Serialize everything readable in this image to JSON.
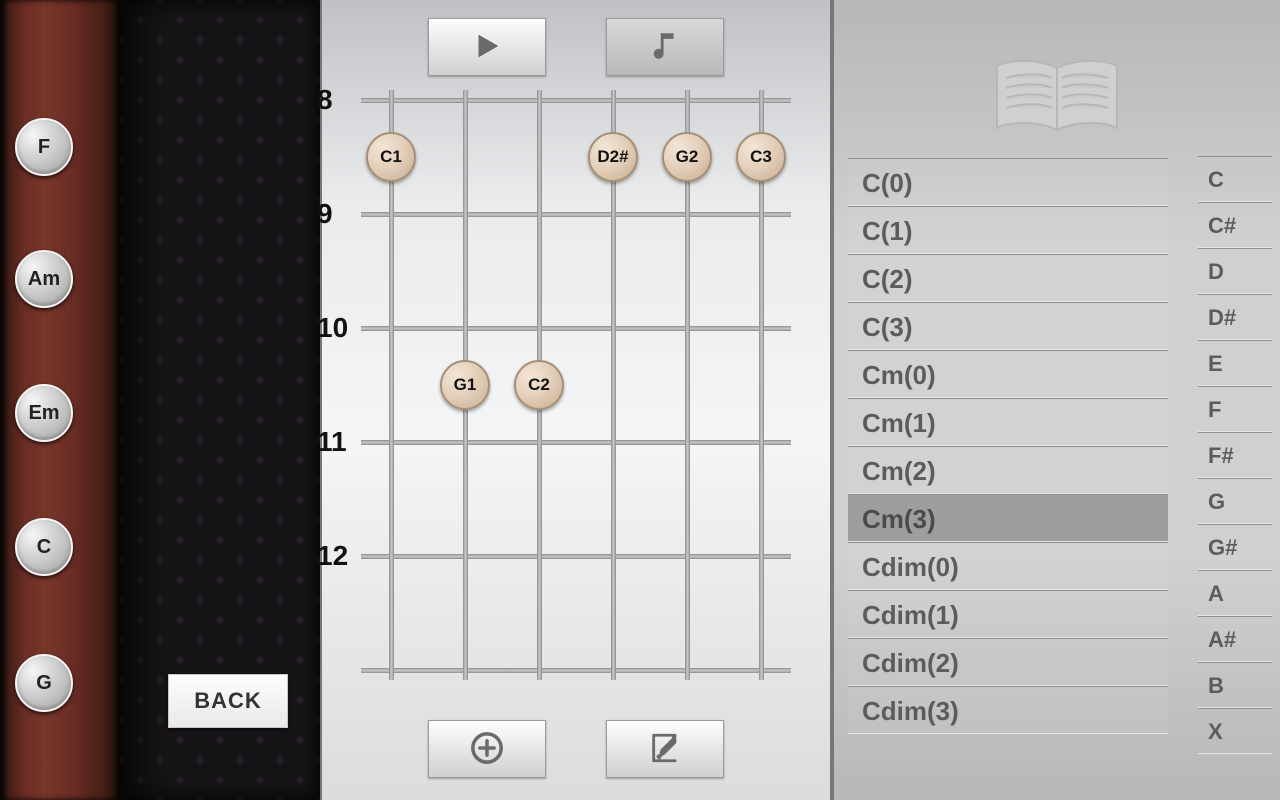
{
  "left_panel": {
    "chord_buttons": [
      "F",
      "Am",
      "Em",
      "C",
      "G"
    ],
    "back_label": "BACK"
  },
  "center_panel": {
    "fretboard": {
      "string_count": 6,
      "fret_labels": [
        "8",
        "9",
        "10",
        "11",
        "12"
      ],
      "dots": [
        {
          "label": "C1",
          "string": 0,
          "row": 0
        },
        {
          "label": "D2#",
          "string": 3,
          "row": 0
        },
        {
          "label": "G2",
          "string": 4,
          "row": 0
        },
        {
          "label": "C3",
          "string": 5,
          "row": 0
        },
        {
          "label": "G1",
          "string": 1,
          "row": 2
        },
        {
          "label": "C2",
          "string": 2,
          "row": 2
        }
      ]
    }
  },
  "right_panel": {
    "chord_variants": [
      "C(0)",
      "C(1)",
      "C(2)",
      "C(3)",
      "Cm(0)",
      "Cm(1)",
      "Cm(2)",
      "Cm(3)",
      "Cdim(0)",
      "Cdim(1)",
      "Cdim(2)",
      "Cdim(3)"
    ],
    "selected_variant": "Cm(3)",
    "keys": [
      "C",
      "C#",
      "D",
      "D#",
      "E",
      "F",
      "F#",
      "G",
      "G#",
      "A",
      "A#",
      "B",
      "X"
    ]
  }
}
